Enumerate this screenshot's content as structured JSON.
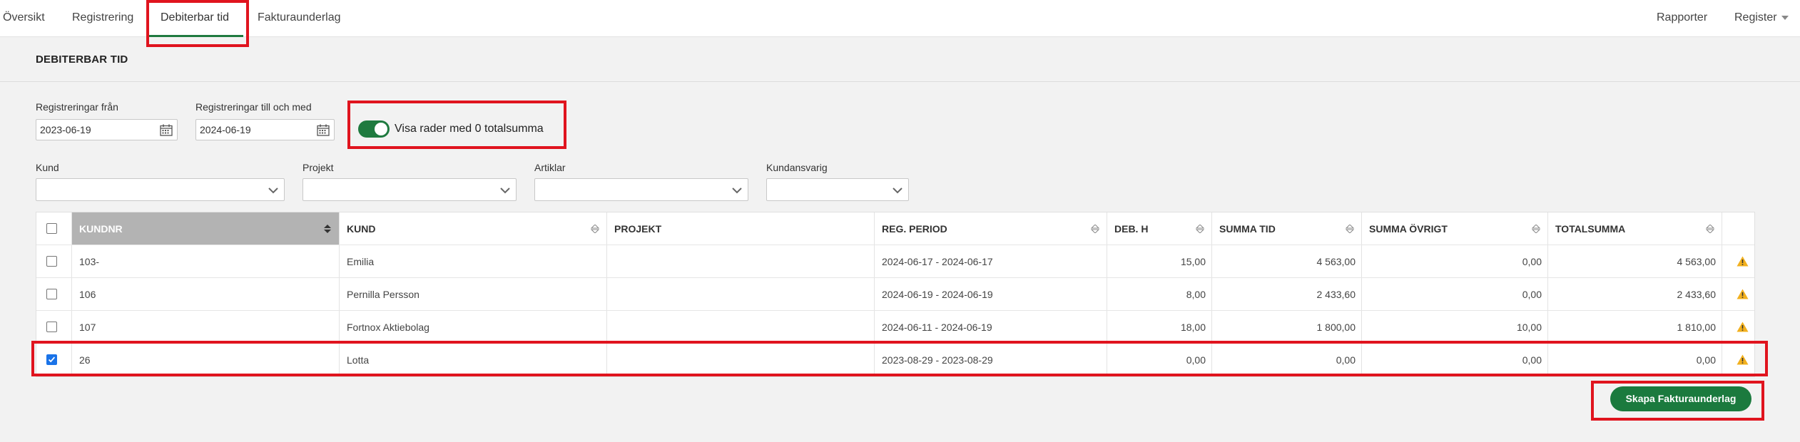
{
  "nav": {
    "tabs": [
      {
        "label": "Översikt"
      },
      {
        "label": "Registrering"
      },
      {
        "label": "Debiterbar tid"
      },
      {
        "label": "Fakturaunderlag"
      }
    ],
    "right": {
      "reports": "Rapporter",
      "register": "Register"
    }
  },
  "page": {
    "title": "DEBITERBAR TID"
  },
  "filters": {
    "from_label": "Registreringar från",
    "from_value": "2023-06-19",
    "to_label": "Registreringar till och med",
    "to_value": "2024-06-19",
    "toggle_label": "Visa rader med 0 totalsumma",
    "toggle_on": true,
    "customer_label": "Kund",
    "customer_value": "",
    "project_label": "Projekt",
    "project_value": "",
    "articles_label": "Artiklar",
    "articles_value": "",
    "responsible_label": "Kundansvarig",
    "responsible_value": ""
  },
  "table": {
    "headers": [
      "KUNDNR",
      "KUND",
      "PROJEKT",
      "REG. PERIOD",
      "DEB. H",
      "SUMMA TID",
      "SUMMA ÖVRIGT",
      "TOTALSUMMA"
    ],
    "rows": [
      {
        "checked": false,
        "kundnr": "103-",
        "kund": "Emilia",
        "projekt": "",
        "period": "2024-06-17 - 2024-06-17",
        "deb_h": "15,00",
        "summa_tid": "4 563,00",
        "summa_ovrigt": "0,00",
        "totalsumma": "4 563,00"
      },
      {
        "checked": false,
        "kundnr": "106",
        "kund": "Pernilla Persson",
        "projekt": "",
        "period": "2024-06-19 - 2024-06-19",
        "deb_h": "8,00",
        "summa_tid": "2 433,60",
        "summa_ovrigt": "0,00",
        "totalsumma": "2 433,60"
      },
      {
        "checked": false,
        "kundnr": "107",
        "kund": "Fortnox Aktiebolag",
        "projekt": "",
        "period": "2024-06-11 - 2024-06-19",
        "deb_h": "18,00",
        "summa_tid": "1 800,00",
        "summa_ovrigt": "10,00",
        "totalsumma": "1 810,00"
      },
      {
        "checked": true,
        "kundnr": "26",
        "kund": "Lotta",
        "projekt": "",
        "period": "2023-08-29 - 2023-08-29",
        "deb_h": "0,00",
        "summa_tid": "0,00",
        "summa_ovrigt": "0,00",
        "totalsumma": "0,00"
      }
    ]
  },
  "actions": {
    "create_invoice_basis": "Skapa Fakturaunderlag"
  },
  "colors": {
    "accent": "#1f7a3f",
    "highlight": "#e0141e",
    "warning": "#f2b01e"
  }
}
